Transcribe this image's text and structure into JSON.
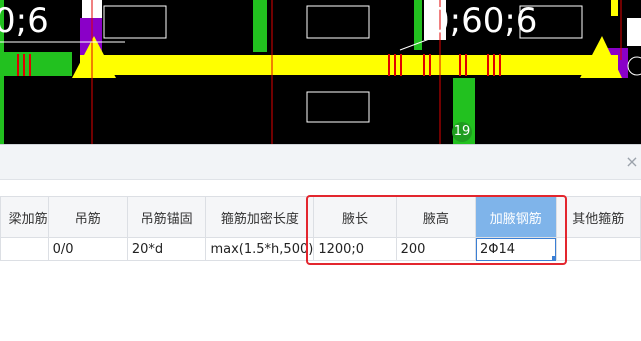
{
  "cad": {
    "label_left": "0;6",
    "label_right": "0;60;6",
    "axis_marker": "19"
  },
  "dialog": {
    "close_icon": "×",
    "columns": [
      {
        "label": "梁加筋"
      },
      {
        "label": "吊筋"
      },
      {
        "label": "吊筋锚固"
      },
      {
        "label": "箍筋加密长度"
      },
      {
        "label": "腋长"
      },
      {
        "label": "腋高"
      },
      {
        "label": "加腋钢筋",
        "selected": true
      },
      {
        "label": "其他箍筋"
      }
    ],
    "row": {
      "c0": "",
      "c1": "0/0",
      "c2": "20*d",
      "c3": "max(1.5*h,500)",
      "c4": "1200;0",
      "c5": "200",
      "c6": "2Φ14",
      "c7": ""
    }
  },
  "colors": {
    "beam": "#ffff00",
    "column": "#8a00c8",
    "green": "#22c11f",
    "red_line": "#e00000",
    "highlight": "#e3262e",
    "selected_header": "#7fb4ea"
  }
}
